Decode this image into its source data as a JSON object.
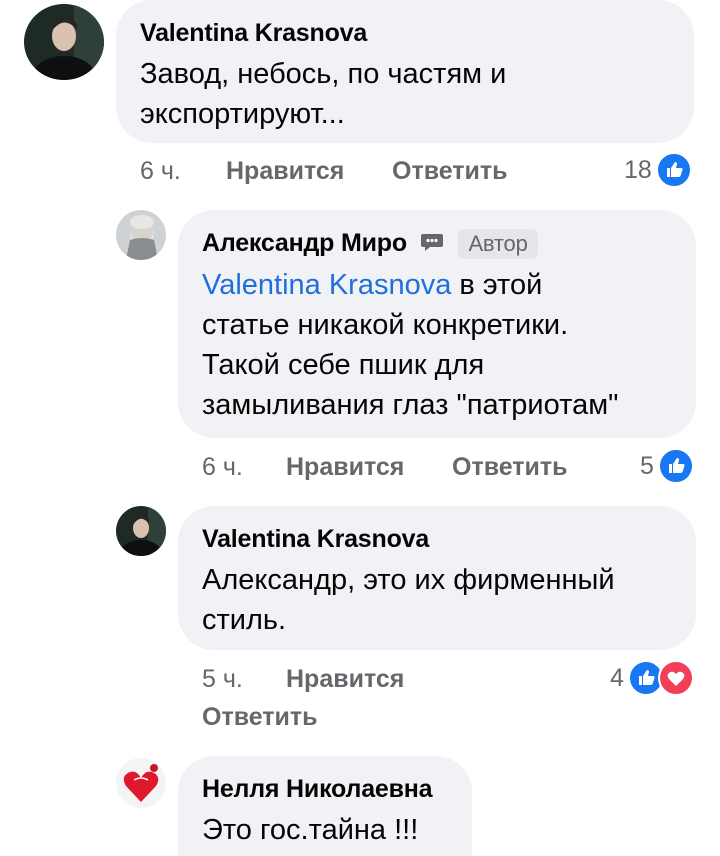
{
  "comments": [
    {
      "author": "Valentina Krasnova",
      "text_lines": [
        "Завод, небось, по частям и",
        "экспортируют..."
      ],
      "time": "6 ч.",
      "like_label": "Нравится",
      "reply_label": "Ответить",
      "reaction_count": "18",
      "reactions": [
        "like"
      ]
    },
    {
      "author": "Александр Миро",
      "badge": "Автор",
      "mention": "Valentina Krasnova",
      "text_lines": [
        " в этой",
        "статье никакой конкретики.",
        "Такой себе пшик для",
        "замыливания глаз \"патриотам\""
      ],
      "time": "6 ч.",
      "like_label": "Нравится",
      "reply_label": "Ответить",
      "reaction_count": "5",
      "reactions": [
        "like"
      ]
    },
    {
      "author": "Valentina Krasnova",
      "text_lines": [
        "Александр, это их фирменный",
        "стиль."
      ],
      "time": "5 ч.",
      "like_label": "Нравится",
      "reply_label": "Ответить",
      "reaction_count": "4",
      "reactions": [
        "like",
        "love"
      ]
    },
    {
      "author": "Нелля Николаевна",
      "text_lines": [
        "Это гос.тайна !!!"
      ]
    }
  ],
  "colors": {
    "bubble": "#f0f2f5",
    "mention": "#216fdb",
    "secondary_text": "#65676b",
    "like": "#1877f2",
    "love": "#f33e58"
  }
}
